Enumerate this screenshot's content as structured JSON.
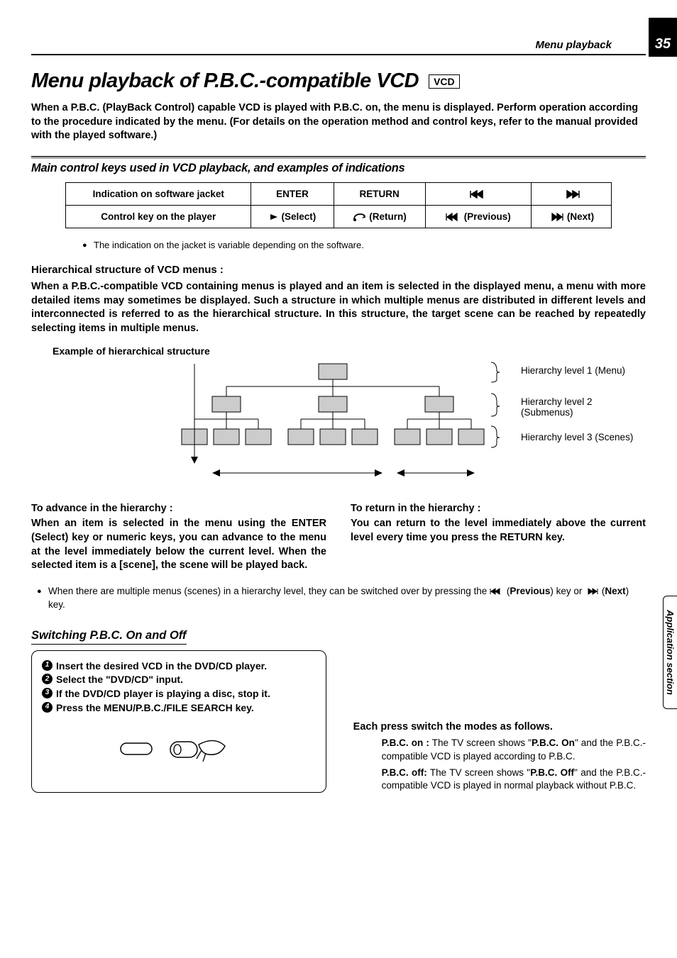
{
  "header": {
    "section": "Menu playback",
    "page": "35"
  },
  "title": "Menu playback of P.B.C.-compatible VCD",
  "badge": "VCD",
  "intro": "When a P.B.C. (PlayBack Control) capable VCD is played with P.B.C. on, the menu is displayed. Perform operation according to the procedure indicated by the menu. (For details on the operation method and control keys, refer to the manual provided with the played software.)",
  "sub1": "Main control keys used in VCD playback, and examples of indications",
  "table": {
    "r1c1": "Indication on software jacket",
    "r1c2": "ENTER",
    "r1c3": "RETURN",
    "r2c1": "Control key on the player",
    "r2c2": "(Select)",
    "r2c3": "(Return)",
    "r2c4": "(Previous)",
    "r2c5": "(Next)"
  },
  "note1": "The indication on the jacket is variable depending on the software.",
  "h3_1": "Hierarchical structure of VCD menus :",
  "body1": "When a P.B.C.-compatible VCD containing menus is played and an item is selected in the displayed menu, a menu with more detailed items may sometimes be displayed. Such a structure in which multiple menus are distributed in different levels and interconnected is referred to as the hierarchical structure. In this structure, the target scene can be reached by repeatedly selecting items in multiple menus.",
  "example_label": "Example of hierarchical structure",
  "legend": {
    "l1": "Hierarchy level 1 (Menu)",
    "l2": "Hierarchy level 2 (Submenus)",
    "l3": "Hierarchy level 3 (Scenes)"
  },
  "cols": {
    "left_title": "To advance in the hierarchy :",
    "left_body": "When an item is selected in the menu using the ENTER (Select)  key or numeric keys, you can advance to the menu at the level immediately below the current level. When the selected item is a [scene], the scene will be played back.",
    "right_title": "To return in the hierarchy :",
    "right_body": "You can return to the level immediately above the current level every time you press the RETURN key."
  },
  "footnote_a": "When there are multiple menus (scenes) in a hierarchy level, they can be switched over by pressing the ",
  "footnote_prev": "Previous",
  "footnote_b": ") key or ",
  "footnote_next": "Next",
  "footnote_c": ") key.",
  "side_tab": "Application section",
  "sect2_title": "Switching P.B.C. On and Off",
  "steps": {
    "s1": "Insert the desired VCD in the DVD/CD player.",
    "s2": "Select the \"DVD/CD\" input.",
    "s3": "If the DVD/CD player is playing a disc, stop it.",
    "s4": "Press the MENU/P.B.C./FILE SEARCH key."
  },
  "right2": {
    "heading": "Each press switch the modes as follows.",
    "on_label": "P.B.C. on :",
    "on_text": " The TV screen shows \"",
    "on_bold": "P.B.C. On",
    "on_text2": "\" and the P.B.C.-compatible VCD is played according to P.B.C.",
    "off_label": "P.B.C. off:",
    "off_text": " The TV screen shows \"",
    "off_bold": "P.B.C. Off",
    "off_text2": "\" and the P.B.C.-compatible VCD is played in normal playback without P.B.C."
  }
}
